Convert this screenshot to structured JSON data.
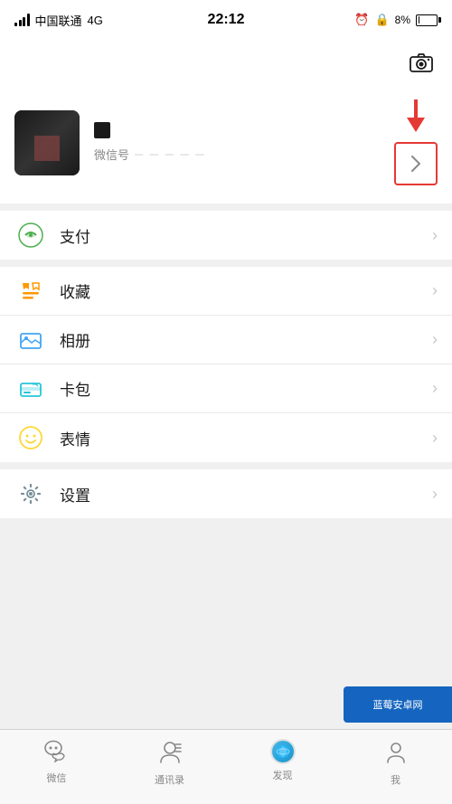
{
  "statusBar": {
    "carrier": "中国联通",
    "network": "4G",
    "time": "22:12",
    "batteryPercent": "8%"
  },
  "header": {
    "cameraLabel": "camera"
  },
  "profile": {
    "wechatIdLabel": "微信号",
    "wechatIdValue": "─ ─ ─ ─ ─",
    "arrowAnnotation": "↓"
  },
  "menu": {
    "items": [
      {
        "id": "payment",
        "label": "支付",
        "iconType": "payment"
      },
      {
        "id": "collect",
        "label": "收藏",
        "iconType": "collect"
      },
      {
        "id": "album",
        "label": "相册",
        "iconType": "album"
      },
      {
        "id": "card",
        "label": "卡包",
        "iconType": "card"
      },
      {
        "id": "emoji",
        "label": "表情",
        "iconType": "emoji"
      }
    ],
    "settings": [
      {
        "id": "settings",
        "label": "设置",
        "iconType": "settings"
      }
    ]
  },
  "tabBar": {
    "items": [
      {
        "id": "wechat",
        "label": "微信",
        "iconSymbol": "💬"
      },
      {
        "id": "contacts",
        "label": "通讯录",
        "iconSymbol": "👤"
      },
      {
        "id": "discover",
        "label": "发现",
        "iconSymbol": "○"
      },
      {
        "id": "me",
        "label": "我",
        "iconSymbol": "─"
      }
    ]
  },
  "watermark": {
    "text": "蓝莓安卓网"
  }
}
